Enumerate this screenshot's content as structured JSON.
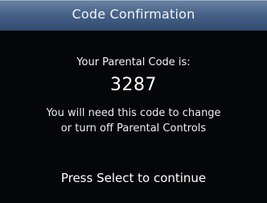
{
  "dialog": {
    "title": "Code Confirmation",
    "heading": "Your Parental Code is:",
    "code": "3287",
    "note_line1": "You will need this code to change",
    "note_line2": "or turn off Parental Controls",
    "prompt": "Press Select to continue"
  },
  "colors": {
    "title_bar": "#4a6488",
    "background": "#05070a",
    "text": "#ffffff"
  }
}
